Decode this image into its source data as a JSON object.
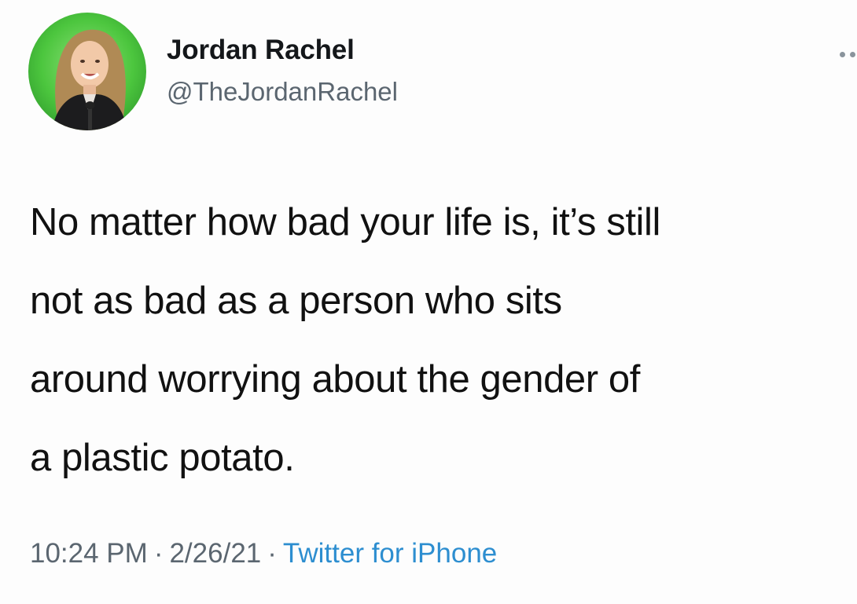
{
  "tweet": {
    "author": {
      "display_name": "Jordan Rachel",
      "handle": "@TheJordanRachel",
      "avatar": "profile-photo"
    },
    "text": "No matter how bad your life is, it’s still\nnot as bad as a person who sits\naround worrying about the gender of\na plastic potato.",
    "meta": {
      "time": "10:24 PM",
      "separator": "·",
      "date": "2/26/21",
      "source": "Twitter for iPhone"
    },
    "more_icon": "more-options-icon"
  },
  "colors": {
    "text": "#111111",
    "secondary": "#5b6670",
    "link": "#2d8ed0",
    "avatar_background": "#3fbf3a"
  }
}
